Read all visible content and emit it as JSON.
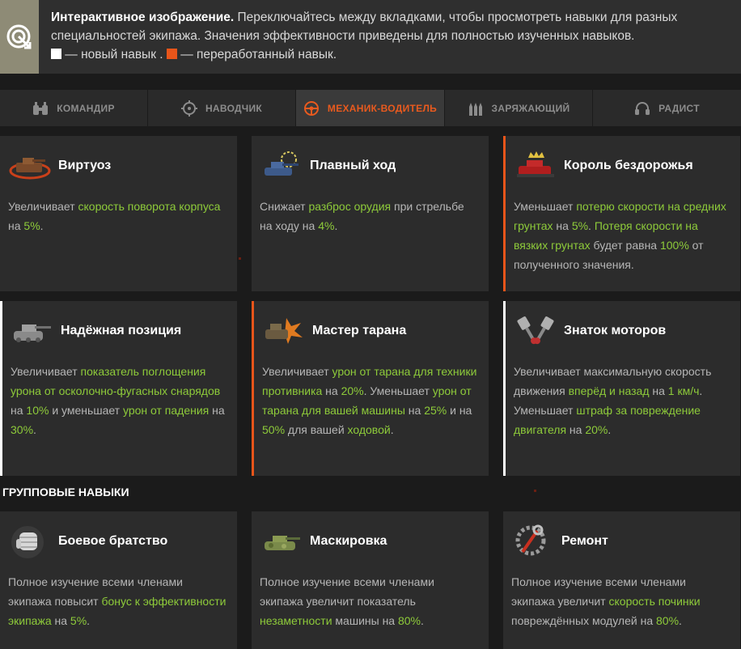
{
  "info": {
    "bold": "Интерактивное изображение.",
    "text": " Переключайтесь между вкладками, чтобы просмотреть навыки для разных специальностей экипажа. Значения эффективности приведены для полностью изученных навыков.",
    "legend_new": " — новый навык . ",
    "legend_reworked": " — переработанный навык."
  },
  "tabs": [
    {
      "label": "КОМАНДИР",
      "icon": "binoculars-icon",
      "active": false
    },
    {
      "label": "НАВОДЧИК",
      "icon": "crosshair-icon",
      "active": false
    },
    {
      "label": "МЕХАНИК-ВОДИТЕЛЬ",
      "icon": "steering-wheel-icon",
      "active": true
    },
    {
      "label": "ЗАРЯЖАЮЩИЙ",
      "icon": "shells-icon",
      "active": false
    },
    {
      "label": "РАДИСТ",
      "icon": "headphones-icon",
      "active": false
    }
  ],
  "cards": [
    {
      "title": "Виртуоз",
      "icon": "tank-turning-icon",
      "mark": "none",
      "desc": [
        [
          "Увеличивает ",
          false
        ],
        [
          "скорость поворота корпуса",
          true
        ],
        [
          " на ",
          false
        ],
        [
          "5%",
          true
        ],
        [
          ".",
          false
        ]
      ]
    },
    {
      "title": "Плавный ход",
      "icon": "tank-aiming-icon",
      "mark": "none",
      "desc": [
        [
          "Снижает ",
          false
        ],
        [
          "разброс орудия",
          true
        ],
        [
          " при стрельбе на ходу на ",
          false
        ],
        [
          "4%",
          true
        ],
        [
          ".",
          false
        ]
      ]
    },
    {
      "title": "Король бездорожья",
      "icon": "crowned-tank-icon",
      "mark": "orange",
      "desc": [
        [
          "Уменьшает ",
          false
        ],
        [
          "потерю скорости на средних грунтах",
          true
        ],
        [
          " на ",
          false
        ],
        [
          "5%",
          true
        ],
        [
          ". ",
          false
        ],
        [
          "Потеря скорости на вязких грунтах",
          true
        ],
        [
          " будет равна ",
          false
        ],
        [
          "100%",
          true
        ],
        [
          " от полученного значения.",
          false
        ]
      ]
    },
    {
      "title": "Надёжная позиция",
      "icon": "tank-cannon-icon",
      "mark": "white",
      "desc": [
        [
          "Увеличивает ",
          false
        ],
        [
          "показатель поглощения урона от осколочно-фугасных снарядов",
          true
        ],
        [
          " на ",
          false
        ],
        [
          "10%",
          true
        ],
        [
          " и уменьшает ",
          false
        ],
        [
          "урон от падения",
          true
        ],
        [
          " на ",
          false
        ],
        [
          "30%",
          true
        ],
        [
          ".",
          false
        ]
      ]
    },
    {
      "title": "Мастер тарана",
      "icon": "tank-ram-icon",
      "mark": "orange",
      "desc": [
        [
          "Увеличивает ",
          false
        ],
        [
          "урон от тарана для техники противника",
          true
        ],
        [
          " на ",
          false
        ],
        [
          "20%",
          true
        ],
        [
          ". Уменьшает ",
          false
        ],
        [
          "урон от тарана для вашей машины",
          true
        ],
        [
          " на ",
          false
        ],
        [
          "25%",
          true
        ],
        [
          " и на ",
          false
        ],
        [
          "50%",
          true
        ],
        [
          " для вашей ",
          false
        ],
        [
          "ходовой",
          true
        ],
        [
          ".",
          false
        ]
      ]
    },
    {
      "title": "Знаток моторов",
      "icon": "pistons-icon",
      "mark": "white",
      "desc": [
        [
          "Увеличивает максимальную скорость движения ",
          false
        ],
        [
          "вперёд и назад",
          true
        ],
        [
          " на ",
          false
        ],
        [
          "1 км/ч",
          true
        ],
        [
          ". Уменьшает ",
          false
        ],
        [
          "штраф за повреждение двигателя",
          true
        ],
        [
          " на ",
          false
        ],
        [
          "20%",
          true
        ],
        [
          ".",
          false
        ]
      ]
    },
    {
      "title": "Боевое братство",
      "icon": "fist-icon",
      "mark": "none",
      "desc": [
        [
          "Полное изучение всеми членами экипажа повысит ",
          false
        ],
        [
          "бонус к эффективности экипажа",
          true
        ],
        [
          " на ",
          false
        ],
        [
          "5%",
          true
        ],
        [
          ".",
          false
        ]
      ]
    },
    {
      "title": "Маскировка",
      "icon": "camo-tank-icon",
      "mark": "none",
      "desc": [
        [
          "Полное изучение всеми членами экипажа увеличит показатель ",
          false
        ],
        [
          "незаметности",
          true
        ],
        [
          " машины на ",
          false
        ],
        [
          "80%",
          true
        ],
        [
          ".",
          false
        ]
      ]
    },
    {
      "title": "Ремонт",
      "icon": "wrench-gear-icon",
      "mark": "none",
      "desc": [
        [
          "Полное изучение всеми членами экипажа увеличит ",
          false
        ],
        [
          "скорость починки",
          true
        ],
        [
          " повреждённых модулей на ",
          false
        ],
        [
          "80%",
          true
        ],
        [
          ".",
          false
        ]
      ]
    }
  ],
  "group_title": "ГРУППОВЫЕ НАВЫКИ",
  "colors": {
    "accent": "#e8551a",
    "highlight": "#8ecb3a",
    "card_bg": "#2c2c2c",
    "page_bg": "#1b1b1b"
  }
}
